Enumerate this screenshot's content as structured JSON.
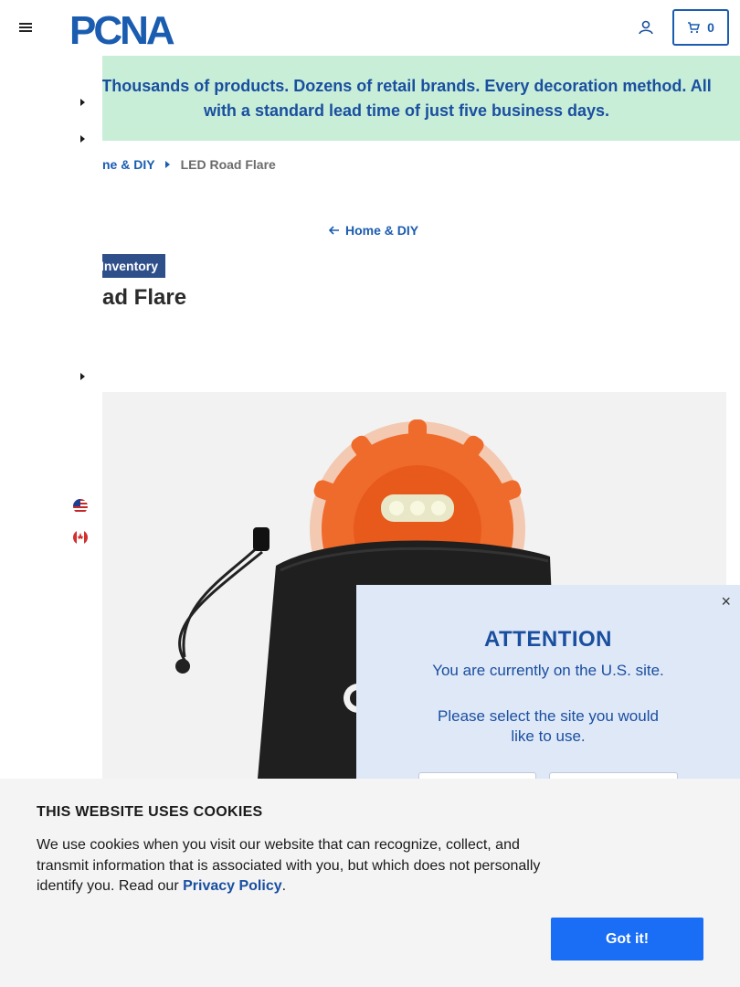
{
  "header": {
    "logo_text": "PCNA",
    "cart_count": "0"
  },
  "promo": {
    "text": "Thousands of products. Dozens of retail brands. Every decoration method. All with a standard lead time of just five business days."
  },
  "breadcrumb": {
    "items": [
      "ne & DIY",
      "LED Road Flare"
    ]
  },
  "back_link": {
    "label": "Home & DIY"
  },
  "product": {
    "badge": "Inventory",
    "title": "ad Flare",
    "image_alt": "LED Road Flare in black drawstring pouch"
  },
  "drawer": {
    "flags": [
      "us-flag-icon",
      "canada-flag-icon"
    ]
  },
  "modal": {
    "close": "×",
    "title": "ATTENTION",
    "line1": "You are currently on the U.S. site.",
    "line2": "Please select the site you would like to use."
  },
  "cookie": {
    "title": "THIS WEBSITE USES COOKIES",
    "body_before": "We use cookies when you visit our website that can recognize, collect, and transmit information that is associated with you, but which does not personally identify you. Read our ",
    "link": "Privacy Policy",
    "body_after": ".",
    "button": "Got it!"
  },
  "colors": {
    "brand_blue": "#1a5cb0",
    "promo_bg": "#c8eed8",
    "badge_bg": "#2f4f8a",
    "modal_bg": "#dfe8f7",
    "cookie_button": "#1a6df5"
  }
}
